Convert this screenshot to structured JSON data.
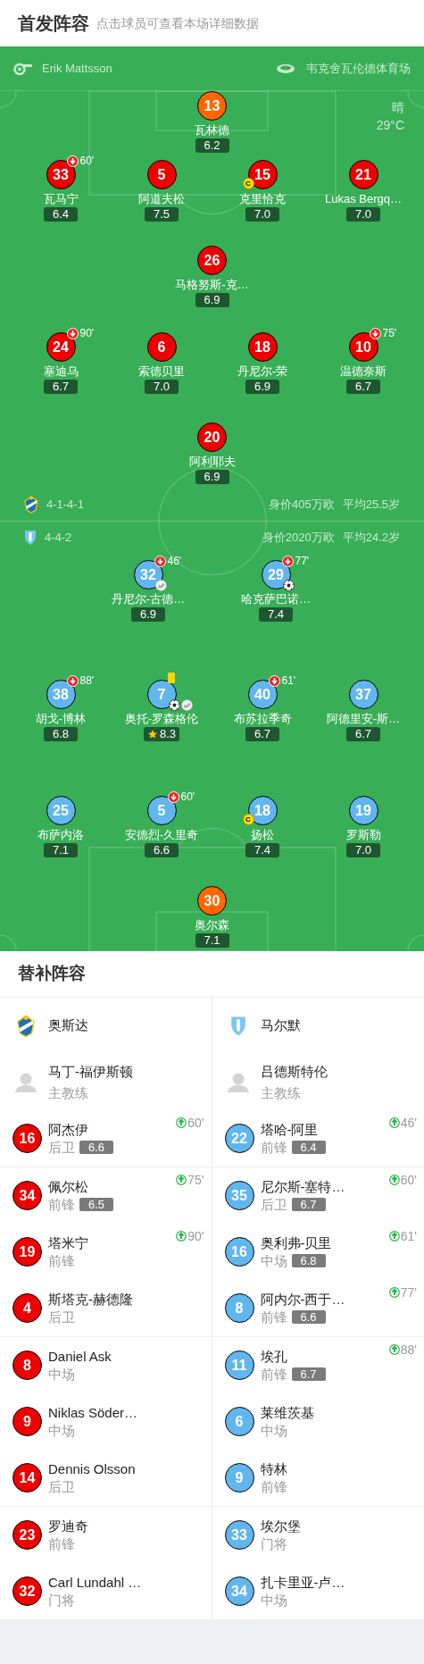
{
  "header": {
    "title": "首发阵容",
    "subtitle": "点击球员可查看本场详细数据"
  },
  "match_info": {
    "referee": "Erik Mattsson",
    "venue": "韦克舍瓦伦德体育场",
    "weather": "晴",
    "temperature": "29°C"
  },
  "home": {
    "formation": "4-1-4-1",
    "value": "身价405万欧",
    "avg_age": "平均25.5岁",
    "lines": [
      {
        "players": [
          {
            "number": "13",
            "name": "瓦林德",
            "rating": "6.2",
            "color": "#ff6600",
            "captain": false,
            "best": false
          }
        ]
      },
      {
        "players": [
          {
            "number": "33",
            "name": "瓦马宁",
            "rating": "6.4",
            "color": "#ee0000",
            "captain": false,
            "best": false,
            "sub_off": "60'"
          },
          {
            "number": "5",
            "name": "阿道夫松",
            "rating": "7.5",
            "color": "#ee0000",
            "captain": false,
            "best": false
          },
          {
            "number": "15",
            "name": "克里恰克",
            "rating": "7.0",
            "color": "#ee0000",
            "captain": true,
            "captain_label": "C",
            "best": false
          },
          {
            "number": "21",
            "name": "Lukas Bergq…",
            "rating": "7.0",
            "color": "#ee0000",
            "captain": false,
            "best": false
          }
        ]
      },
      {
        "players": [
          {
            "number": "26",
            "name": "马格努斯-克…",
            "rating": "6.9",
            "color": "#ee0000",
            "captain": false,
            "best": false
          }
        ]
      },
      {
        "players": [
          {
            "number": "24",
            "name": "塞迪乌",
            "rating": "6.7",
            "color": "#ee0000",
            "captain": false,
            "best": false,
            "sub_off": "90'"
          },
          {
            "number": "6",
            "name": "索德贝里",
            "rating": "7.0",
            "color": "#ee0000",
            "captain": false,
            "best": false
          },
          {
            "number": "18",
            "name": "丹尼尔-荣",
            "rating": "6.9",
            "color": "#ee0000",
            "captain": false,
            "best": false
          },
          {
            "number": "10",
            "name": "温德奈斯",
            "rating": "6.7",
            "color": "#ee0000",
            "captain": false,
            "best": false,
            "sub_off": "75'"
          }
        ]
      },
      {
        "players": [
          {
            "number": "20",
            "name": "阿利耶夫",
            "rating": "6.9",
            "color": "#ee0000",
            "captain": false,
            "best": false
          }
        ]
      }
    ]
  },
  "away": {
    "formation": "4-4-2",
    "value": "身价2020万欧",
    "avg_age": "平均24.2岁",
    "lines": [
      {
        "players": [
          {
            "number": "32",
            "name": "丹尼尔-古德…",
            "rating": "6.9",
            "color": "#62b6ee",
            "captain": false,
            "best": false,
            "sub_off": "46'",
            "events": [
              {
                "kind": "assist"
              }
            ]
          },
          {
            "number": "29",
            "name": "哈克萨巴诺…",
            "rating": "7.4",
            "color": "#62b6ee",
            "captain": false,
            "best": false,
            "sub_off": "77'",
            "events": [
              {
                "kind": "goal"
              }
            ]
          }
        ]
      },
      {
        "players": [
          {
            "number": "38",
            "name": "胡戈-博林",
            "rating": "6.8",
            "color": "#62b6ee",
            "captain": false,
            "best": false,
            "sub_off": "88'"
          },
          {
            "number": "7",
            "name": "奥托-罗森格伦",
            "rating": "8.3",
            "color": "#62b6ee",
            "captain": false,
            "best": true,
            "events": [
              {
                "kind": "yellow_card"
              },
              {
                "kind": "goal"
              },
              {
                "kind": "assist"
              }
            ]
          },
          {
            "number": "40",
            "name": "布苏拉季奇",
            "rating": "6.7",
            "color": "#62b6ee",
            "captain": false,
            "best": false,
            "sub_off": "61'"
          },
          {
            "number": "37",
            "name": "阿德里安-斯…",
            "rating": "6.7",
            "color": "#62b6ee",
            "captain": false,
            "best": false
          }
        ]
      },
      {
        "players": [
          {
            "number": "25",
            "name": "布萨内洛",
            "rating": "7.1",
            "color": "#62b6ee",
            "captain": false,
            "best": false
          },
          {
            "number": "5",
            "name": "安德烈-久里奇",
            "rating": "6.6",
            "color": "#62b6ee",
            "captain": false,
            "best": false,
            "sub_off": "60'"
          },
          {
            "number": "18",
            "name": "扬松",
            "rating": "7.4",
            "color": "#62b6ee",
            "captain": true,
            "captain_label": "C",
            "best": false
          },
          {
            "number": "19",
            "name": "罗斯勒",
            "rating": "7.0",
            "color": "#62b6ee",
            "captain": false,
            "best": false
          }
        ]
      },
      {
        "players": [
          {
            "number": "30",
            "name": "奥尔森",
            "rating": "7.1",
            "color": "#ff6600",
            "captain": false,
            "best": false
          }
        ]
      }
    ]
  },
  "subs": {
    "title": "替补阵容",
    "teams": [
      {
        "name": "奥斯达",
        "coach": {
          "name": "马丁-福伊斯顿",
          "role": "主教练"
        },
        "players": [
          {
            "number": "16",
            "name": "阿杰伊",
            "position": "后卫",
            "rating": "6.6",
            "sub_on": "60'",
            "color": "#ee0000"
          },
          {
            "number": "34",
            "name": "佩尔松",
            "position": "前锋",
            "rating": "6.5",
            "sub_on": "75'",
            "color": "#ee0000"
          },
          {
            "number": "19",
            "name": "塔米宁",
            "position": "前锋",
            "sub_on": "90'",
            "color": "#ee0000"
          },
          {
            "number": "4",
            "name": "斯塔克-赫德隆",
            "position": "后卫",
            "color": "#ee0000"
          },
          {
            "number": "8",
            "name": "Daniel Ask",
            "position": "中场",
            "color": "#ee0000"
          },
          {
            "number": "9",
            "name": "Niklas Söder…",
            "position": "中场",
            "color": "#ee0000"
          },
          {
            "number": "14",
            "name": "Dennis Olsson",
            "position": "后卫",
            "color": "#ee0000"
          },
          {
            "number": "23",
            "name": "罗迪奇",
            "position": "前锋",
            "color": "#ee0000"
          },
          {
            "number": "32",
            "name": "Carl Lundahl …",
            "position": "门将",
            "color": "#ee0000"
          }
        ]
      },
      {
        "name": "马尔默",
        "coach": {
          "name": "吕德斯特伦",
          "role": "主教练"
        },
        "players": [
          {
            "number": "22",
            "name": "塔哈-阿里",
            "position": "前锋",
            "rating": "6.4",
            "sub_on": "46'",
            "color": "#62b6ee"
          },
          {
            "number": "35",
            "name": "尼尔斯-塞特…",
            "position": "后卫",
            "rating": "6.7",
            "sub_on": "60'",
            "color": "#62b6ee"
          },
          {
            "number": "16",
            "name": "奥利弗-贝里",
            "position": "中场",
            "rating": "6.8",
            "sub_on": "61'",
            "color": "#62b6ee"
          },
          {
            "number": "8",
            "name": "阿内尔-西于…",
            "position": "前锋",
            "rating": "6.6",
            "sub_on": "77'",
            "color": "#62b6ee"
          },
          {
            "number": "11",
            "name": "埃孔",
            "position": "前锋",
            "rating": "6.7",
            "sub_on": "88'",
            "color": "#62b6ee"
          },
          {
            "number": "6",
            "name": "莱维茨基",
            "position": "中场",
            "color": "#62b6ee"
          },
          {
            "number": "9",
            "name": "特林",
            "position": "前锋",
            "color": "#62b6ee"
          },
          {
            "number": "33",
            "name": "埃尔堡",
            "position": "门将",
            "color": "#62b6ee"
          },
          {
            "number": "34",
            "name": "扎卡里亚-卢…",
            "position": "中场",
            "color": "#62b6ee"
          }
        ]
      }
    ]
  }
}
